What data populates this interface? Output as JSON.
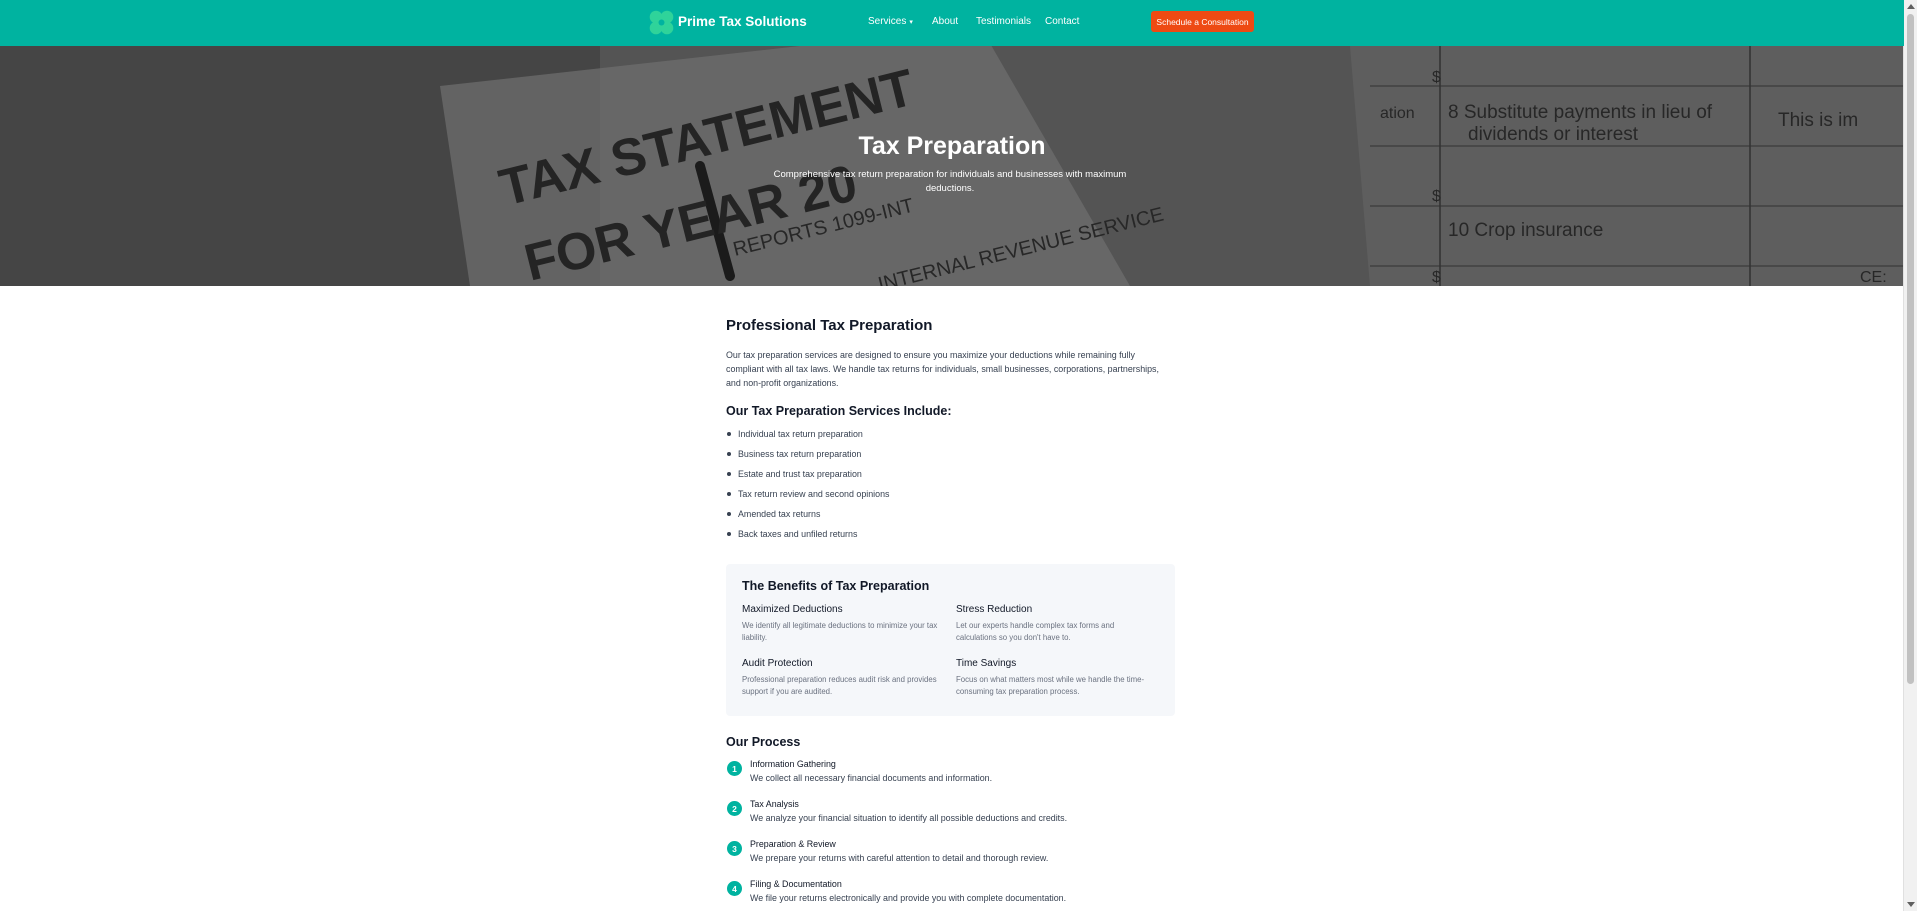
{
  "header": {
    "brand": "Prime Tax Solutions",
    "logo_icon": "clover-icon",
    "nav": [
      {
        "label": "Services",
        "has_dropdown": true
      },
      {
        "label": "About"
      },
      {
        "label": "Testimonials"
      },
      {
        "label": "Contact"
      }
    ],
    "cta": "Schedule a Consultation",
    "colors": {
      "header_bg": "#00b3a0",
      "cta_bg": "#ee4a13"
    }
  },
  "hero": {
    "title": "Tax Preparation",
    "subtitle": "Comprehensive tax return preparation for individuals and businesses with maximum deductions.",
    "background_image": {
      "texts": [
        "TAX STATEMENT",
        "FOR YEAR 20",
        "REPORTS 1099-INT",
        "INTERNAL REVENUE SERVICE",
        "8 Substitute payments in lieu of",
        "dividends or interest",
        "10 Crop insurance",
        "This is im",
        "ation",
        "$",
        "$",
        "$",
        "CE:"
      ]
    }
  },
  "main": {
    "title": "Professional Tax Preparation",
    "intro": "Our tax preparation services are designed to ensure you maximize your deductions while remaining fully compliant with all tax laws. We handle tax returns for individuals, small businesses, corporations, partnerships, and non-profit organizations.",
    "services_title": "Our Tax Preparation Services Include:",
    "services": [
      "Individual tax return preparation",
      "Business tax return preparation",
      "Estate and trust tax preparation",
      "Tax return review and second opinions",
      "Amended tax returns",
      "Back taxes and unfiled returns"
    ],
    "benefits": {
      "title": "The Benefits of Tax Preparation",
      "items": [
        {
          "title": "Maximized Deductions",
          "desc": "We identify all legitimate deductions to minimize your tax liability."
        },
        {
          "title": "Stress Reduction",
          "desc": "Let our experts handle complex tax forms and calculations so you don't have to."
        },
        {
          "title": "Audit Protection",
          "desc": "Professional preparation reduces audit risk and provides support if you are audited."
        },
        {
          "title": "Time Savings",
          "desc": "Focus on what matters most while we handle the time-consuming tax preparation process."
        }
      ]
    },
    "process": {
      "title": "Our Process",
      "steps": [
        {
          "num": "1",
          "title": "Information Gathering",
          "desc": "We collect all necessary financial documents and information."
        },
        {
          "num": "2",
          "title": "Tax Analysis",
          "desc": "We analyze your financial situation to identify all possible deductions and credits."
        },
        {
          "num": "3",
          "title": "Preparation & Review",
          "desc": "We prepare your returns with careful attention to detail and thorough review."
        },
        {
          "num": "4",
          "title": "Filing & Documentation",
          "desc": "We file your returns electronically and provide you with complete documentation."
        }
      ]
    }
  }
}
